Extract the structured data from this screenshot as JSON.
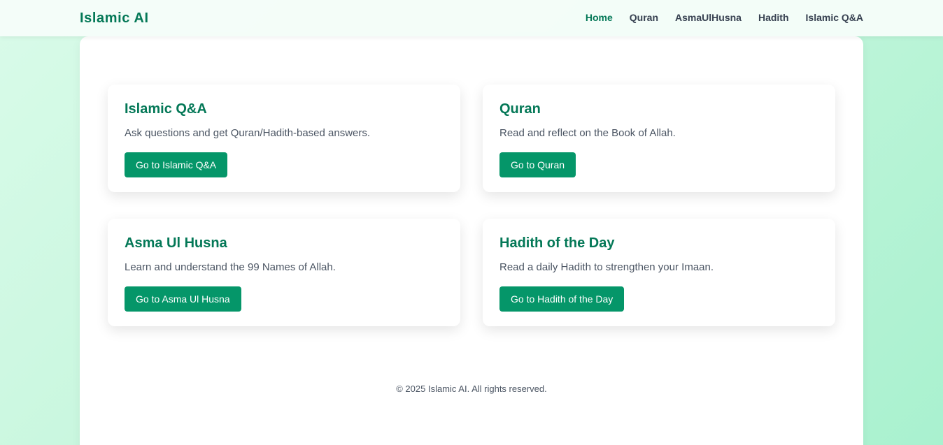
{
  "brand": "Islamic AI",
  "nav": [
    {
      "label": "Home",
      "active": true
    },
    {
      "label": "Quran",
      "active": false
    },
    {
      "label": "AsmaUlHusna",
      "active": false
    },
    {
      "label": "Hadith",
      "active": false
    },
    {
      "label": "Islamic Q&A",
      "active": false
    }
  ],
  "cards": [
    {
      "title": "Islamic Q&A",
      "description": "Ask questions and get Quran/Hadith-based answers.",
      "button": "Go to Islamic Q&A"
    },
    {
      "title": "Quran",
      "description": "Read and reflect on the Book of Allah.",
      "button": "Go to Quran"
    },
    {
      "title": "Asma Ul Husna",
      "description": "Learn and understand the 99 Names of Allah.",
      "button": "Go to Asma Ul Husna"
    },
    {
      "title": "Hadith of the Day",
      "description": "Read a daily Hadith to strengthen your Imaan.",
      "button": "Go to Hadith of the Day"
    }
  ],
  "footer": "© 2025 Islamic AI. All rights reserved.",
  "colors": {
    "brand_green": "#047857",
    "button_green": "#059669",
    "text_gray": "#374151"
  }
}
